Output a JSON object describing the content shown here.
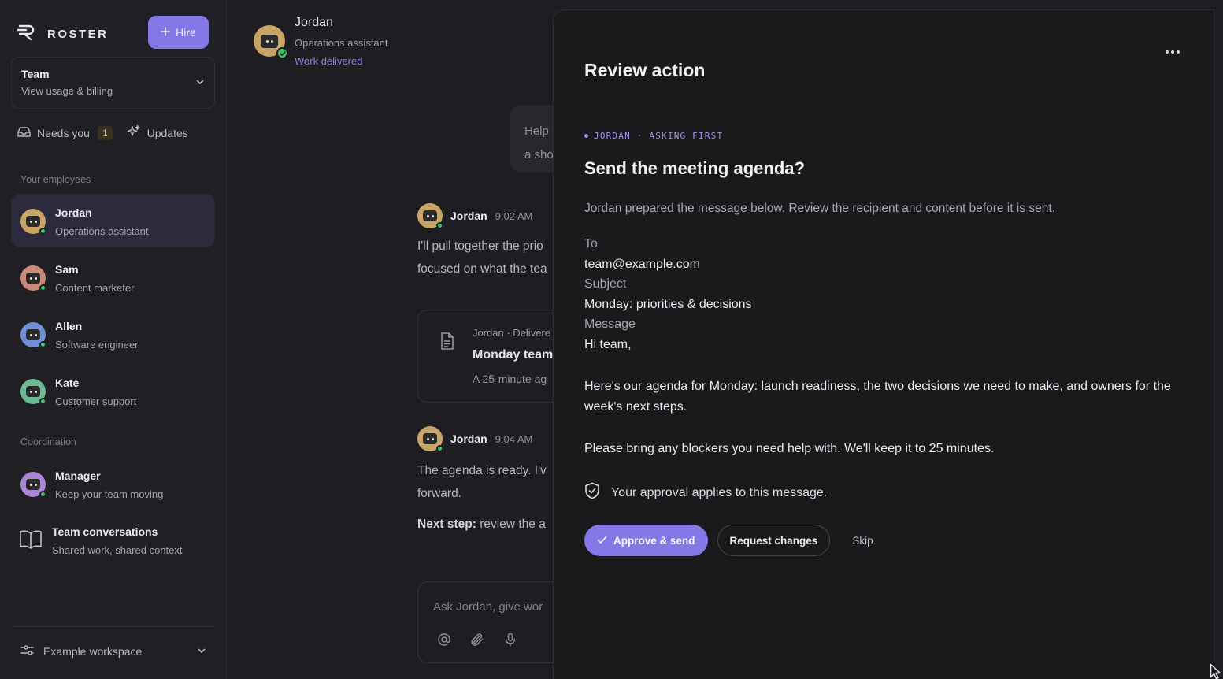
{
  "sidebar": {
    "brand": "ROSTER",
    "hire_label": "Hire",
    "team": {
      "title": "Team",
      "subtitle": "View usage & billing"
    },
    "needs_you": {
      "label": "Needs you",
      "count": "1"
    },
    "updates_label": "Updates",
    "employees_label": "Your employees",
    "employees": [
      {
        "name": "Jordan",
        "role": "Operations assistant",
        "color": "#c9a467"
      },
      {
        "name": "Sam",
        "role": "Content marketer",
        "color": "#c98a7a"
      },
      {
        "name": "Allen",
        "role": "Software engineer",
        "color": "#6f8fd6"
      },
      {
        "name": "Kate",
        "role": "Customer support",
        "color": "#6dbb95"
      }
    ],
    "coordination_label": "Coordination",
    "manager": {
      "name": "Manager",
      "role": "Keep your team moving",
      "color": "#a987d6"
    },
    "conversations": {
      "name": "Team conversations",
      "role": "Shared work, shared context"
    },
    "workspace": "Example workspace"
  },
  "chat": {
    "header": {
      "name": "Jordan",
      "role": "Operations assistant",
      "status": "Work delivered"
    },
    "user_bubble": {
      "line1": "Help",
      "line2": "a sho"
    },
    "messages": [
      {
        "name": "Jordan",
        "time": "9:02 AM",
        "line1": "I'll pull together the prio",
        "line2": "focused on what the tea"
      },
      {
        "name": "Jordan",
        "time": "9:04 AM",
        "line1": "The agenda is ready. I'v",
        "line2": "forward.",
        "next_label": "Next step:",
        "next_text": " review the a"
      }
    ],
    "deliverable": {
      "meta": "Jordan · Delivere",
      "title": "Monday team",
      "desc": "A 25-minute ag"
    },
    "composer_placeholder": "Ask Jordan, give wor"
  },
  "review": {
    "title": "Review action",
    "eyebrow": "JORDAN · ASKING FIRST",
    "question": "Send the meeting agenda?",
    "description": "Jordan prepared the message below. Review the recipient and content before it is sent.",
    "to_label": "To",
    "to_value": "team@example.com",
    "subject_label": "Subject",
    "subject_value": "Monday: priorities & decisions",
    "message_label": "Message",
    "message_greeting": "Hi team,",
    "message_p1": "Here's our agenda for Monday: launch readiness, the two decisions we need to make, and owners for the week's next steps.",
    "message_p2": "Please bring any blockers you need help with. We'll keep it to 25 minutes.",
    "approval_note": "Your approval applies to this message.",
    "approve_label": "Approve & send",
    "request_label": "Request changes",
    "skip_label": "Skip"
  },
  "colors": {
    "accent": "#8478e6",
    "status_online": "#3fbf6a",
    "background": "#1e1e22",
    "panel": "#1a1a1d"
  }
}
